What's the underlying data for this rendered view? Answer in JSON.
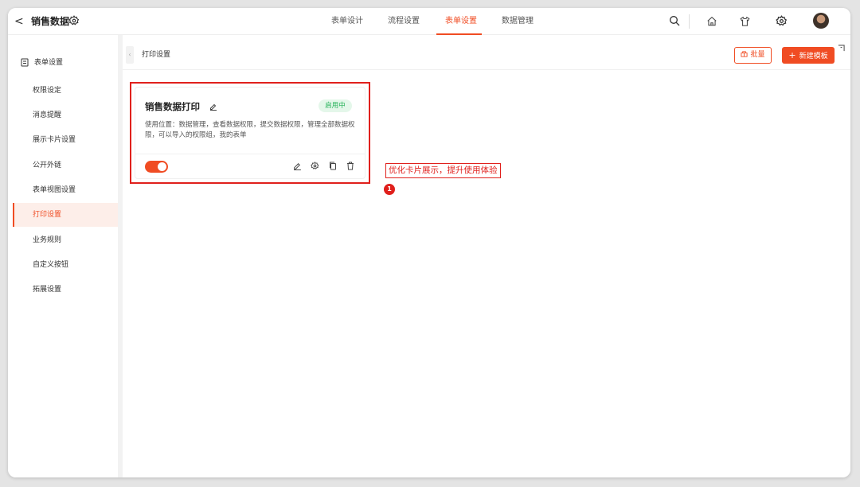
{
  "app": {
    "back_label": "<",
    "title": "销售数据"
  },
  "tabs": [
    {
      "label": "表单设计",
      "active": false
    },
    {
      "label": "流程设置",
      "active": false
    },
    {
      "label": "表单设置",
      "active": true
    },
    {
      "label": "数据管理",
      "active": false
    }
  ],
  "toolbar_icons": [
    "search-icon",
    "home-icon",
    "shirt-icon",
    "gear-icon",
    "avatar"
  ],
  "sidebar": {
    "header": "表单设置",
    "items": [
      {
        "label": "权限设定",
        "active": false
      },
      {
        "label": "消息提醒",
        "active": false
      },
      {
        "label": "展示卡片设置",
        "active": false
      },
      {
        "label": "公开外链",
        "active": false
      },
      {
        "label": "表单视图设置",
        "active": false
      },
      {
        "label": "打印设置",
        "active": true
      },
      {
        "label": "业务规则",
        "active": false
      },
      {
        "label": "自定义按钮",
        "active": false
      },
      {
        "label": "拓展设置",
        "active": false
      }
    ]
  },
  "content": {
    "page_title": "打印设置",
    "batch_button": "批量",
    "new_template_button": "新建模板"
  },
  "card": {
    "title": "销售数据打印",
    "status": "启用中",
    "description": "使用位置：数据管理，查看数据权限，提交数据权限，管理全部数据权限，可以导入的权限组，我的表单",
    "enabled": true
  },
  "annotation": {
    "callout_text": "优化卡片展示，提升使用体验",
    "marker": "1"
  },
  "colors": {
    "accent": "#f04c23",
    "highlight": "#e0201c",
    "status_green": "#26b25a"
  }
}
